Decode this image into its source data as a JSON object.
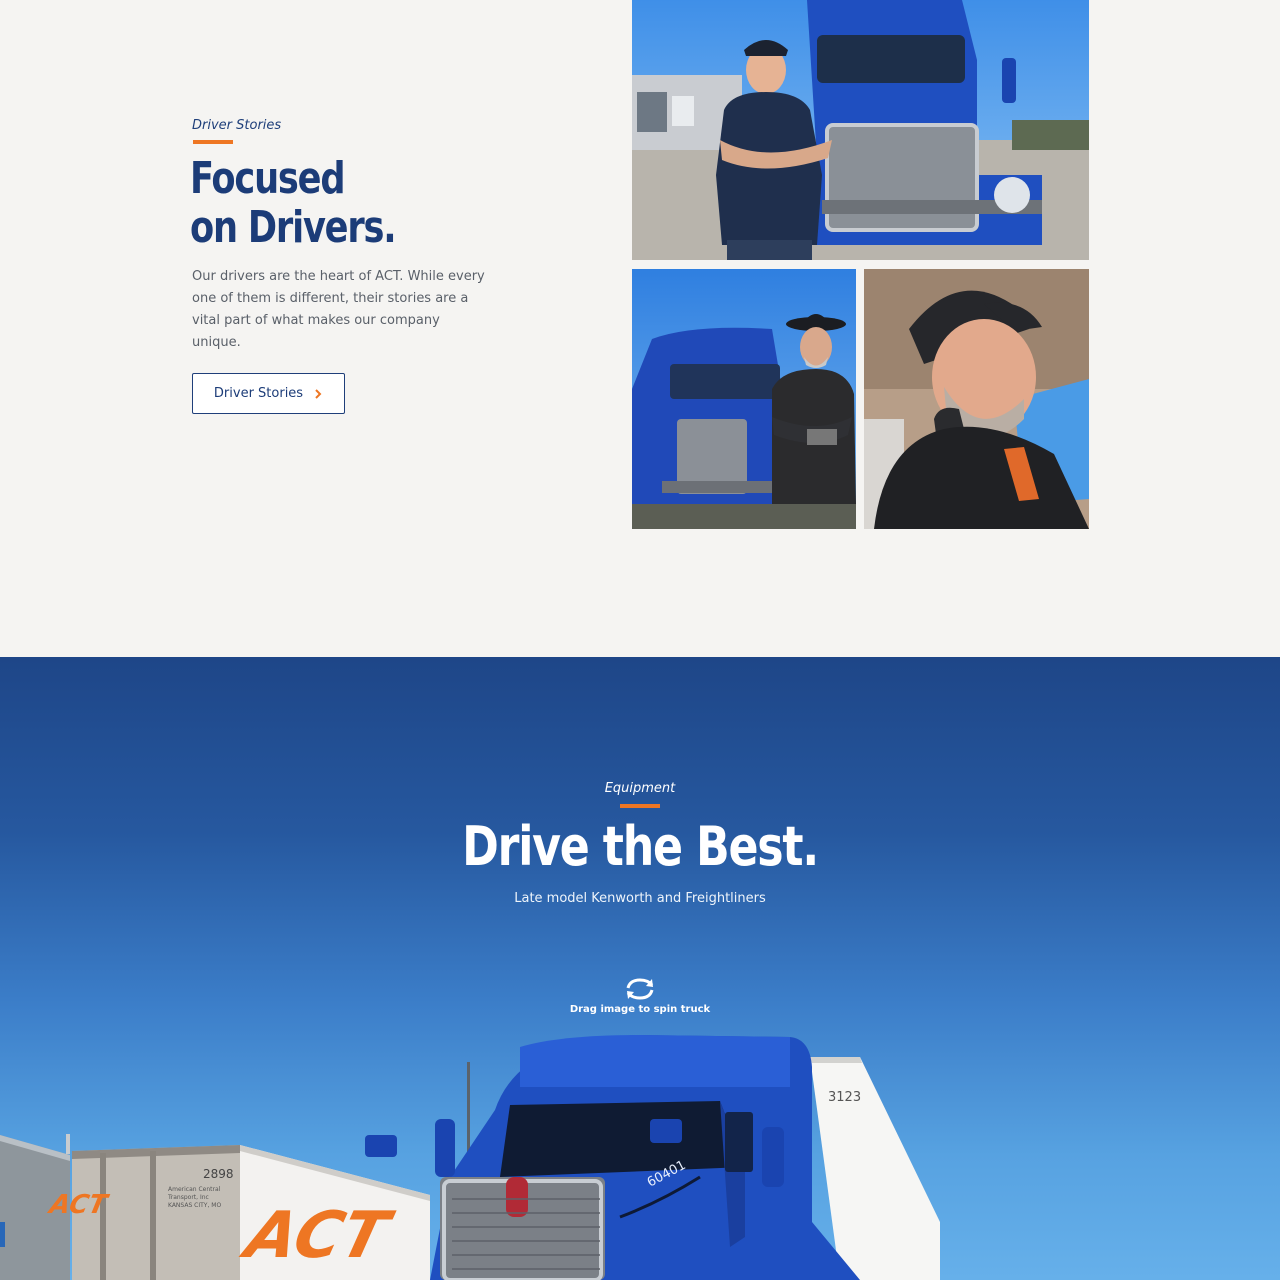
{
  "drivers_section": {
    "eyebrow": "Driver Stories",
    "headline_line1": "Focused",
    "headline_line2": "on Drivers.",
    "body_line1": "Our drivers are the heart of ACT. While every",
    "body_line2": "one of them is different, their stories are a",
    "body_line3": "vital part of what makes our company unique.",
    "button_label": "Driver Stories",
    "photos": [
      "photo-driver-arms-crossed",
      "photo-driver-cowboy-hat",
      "photo-driver-in-cab"
    ]
  },
  "equipment_section": {
    "eyebrow": "Equipment",
    "title": "Drive the Best.",
    "subtitle": "Late model Kenworth and Freightliners",
    "spin_hint": "Drag image to spin truck",
    "truck_unit_number": "60401",
    "trailer_number_left": "2898",
    "trailer_number_right": "3123",
    "trailer_caption_line1": "American Central",
    "trailer_caption_line2": "Transport, Inc",
    "trailer_caption_line3": "KANSAS CITY, MO",
    "trailer_logo_text": "ACT"
  },
  "colors": {
    "brand_blue": "#1c3c78",
    "accent_orange": "#ee7623",
    "page_bg": "#f5f4f2",
    "truck_blue": "#1f4fc0"
  }
}
